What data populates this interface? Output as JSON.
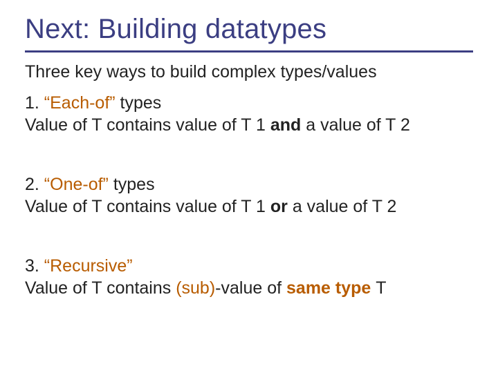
{
  "title": "Next: Building datatypes",
  "lead": "Three key ways to build complex types/values",
  "items": [
    {
      "num": "1. ",
      "name": "“Each-of”",
      "name_suffix": " types",
      "desc_pre": "Value of T contains value of T 1 ",
      "desc_kw": "and",
      "desc_post": " a value of T 2"
    },
    {
      "num": "2. ",
      "name": "“One-of”",
      "name_suffix": " types",
      "desc_pre": "Value of T contains value of T 1 ",
      "desc_kw": "or",
      "desc_post": " a value of T 2"
    },
    {
      "num": "3. ",
      "name": "“Recursive”",
      "name_suffix": "",
      "desc_pre": "Value of T contains ",
      "desc_mid_colored": "(sub)",
      "desc_mid_plain": "-value of ",
      "desc_kw": "same type ",
      "desc_post": "T"
    }
  ]
}
